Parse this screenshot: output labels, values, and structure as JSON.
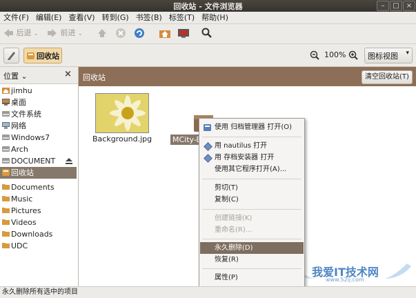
{
  "window": {
    "title": "回收站 - 文件浏览器",
    "controls": {
      "minimize": "–",
      "maximize": "□",
      "close": "×"
    }
  },
  "menubar": {
    "items": [
      "文件(F)",
      "编辑(E)",
      "查看(V)",
      "转到(G)",
      "书签(B)",
      "标签(T)",
      "帮助(H)"
    ]
  },
  "toolbar": {
    "back_label": "后退",
    "forward_label": "前进"
  },
  "location": {
    "current_label": "回收站",
    "zoom_level": "100%",
    "view_mode": "图标视图"
  },
  "sidebar": {
    "header": "位置",
    "close_glyph": "×",
    "items": [
      {
        "label": "jimhu",
        "icon": "home-folder-icon"
      },
      {
        "label": "桌面",
        "icon": "desktop-icon"
      },
      {
        "label": "文件系统",
        "icon": "drive-icon"
      },
      {
        "label": "网络",
        "icon": "network-icon"
      },
      {
        "label": "Windows7",
        "icon": "drive-icon"
      },
      {
        "label": "Arch",
        "icon": "drive-icon"
      },
      {
        "label": "DOCUMENT",
        "icon": "drive-icon"
      },
      {
        "label": "回收站",
        "icon": "trash-icon"
      },
      {
        "label": "Documents",
        "icon": "folder-icon"
      },
      {
        "label": "Music",
        "icon": "folder-icon"
      },
      {
        "label": "Pictures",
        "icon": "folder-icon"
      },
      {
        "label": "Videos",
        "icon": "folder-icon"
      },
      {
        "label": "Downloads",
        "icon": "folder-icon"
      },
      {
        "label": "UDC",
        "icon": "folder-icon"
      }
    ]
  },
  "main": {
    "path_label": "回收站",
    "empty_trash_button": "清空回收站(T)",
    "files": [
      {
        "name": "Background.jpg"
      },
      {
        "name": "MCity-B"
      }
    ]
  },
  "context_menu": {
    "items": [
      {
        "label": "使用 归档管理器 打开(O)",
        "icon": "archive-manager-icon",
        "enabled": true
      },
      {
        "label": "用 nautilus 打开",
        "icon": "diamond-icon",
        "enabled": true
      },
      {
        "label": "用 存档安装器 打开",
        "icon": "diamond-icon",
        "enabled": true
      },
      {
        "label": "使用其它程序打开(A)...",
        "icon": "",
        "enabled": true
      },
      {
        "label": "剪切(T)",
        "icon": "",
        "enabled": true
      },
      {
        "label": "复制(C)",
        "icon": "",
        "enabled": true
      },
      {
        "label": "创建链接(K)",
        "icon": "",
        "enabled": false
      },
      {
        "label": "重命名(R)...",
        "icon": "",
        "enabled": false
      },
      {
        "label": "永久删除(D)",
        "icon": "",
        "enabled": true,
        "highlighted": true
      },
      {
        "label": "恢复(R)",
        "icon": "",
        "enabled": true
      },
      {
        "label": "属性(P)",
        "icon": "",
        "enabled": true
      }
    ]
  },
  "status_bar": {
    "text": "永久删除所有选中的项目"
  },
  "watermark": {
    "text": "我爱IT技术网",
    "url": "www.52ij.com"
  },
  "colors": {
    "selection": "#86786a",
    "pathbar": "#8d6e56",
    "menu_highlight": "#7d6e5f"
  }
}
